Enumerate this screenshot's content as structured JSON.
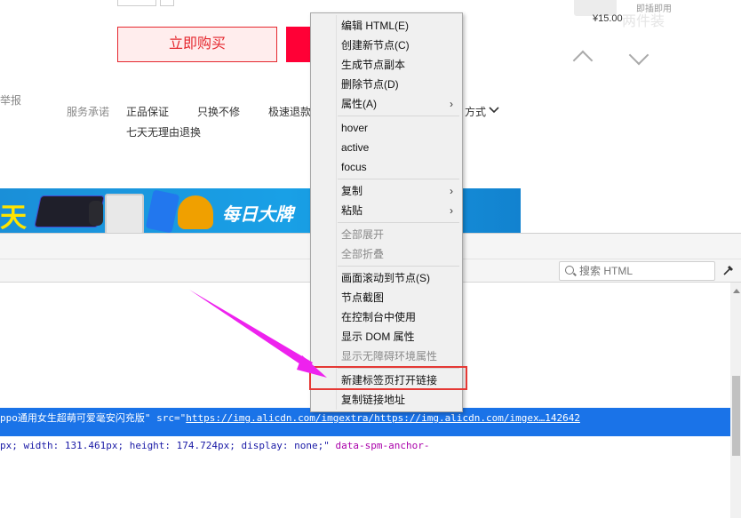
{
  "page": {
    "buy_now": "立即购买",
    "report_partial": "举报",
    "service_label": "服务承诺",
    "services": [
      "正品保证",
      "只换不修",
      "极速退款",
      "七天无理由退换"
    ],
    "payment_partial": "方式",
    "product_small_text": "即插即用",
    "product_ghost_text": "两件装",
    "product_price": "¥15.00",
    "banner_left": "天",
    "banner_text": "每日大牌"
  },
  "devtools": {
    "search_placeholder": "搜索 HTML",
    "selected_line": {
      "prefix": "ppo通用女生超萌可爱毫安闪充版\" src=\"",
      "url": "https://img.alicdn.com/imgextra/https://img.alicdn.com/imgex…142642"
    },
    "style_line": {
      "text": "px; width: 131.461px; height: 174.724px; display: none;\"",
      "attr": " data-spm-anchor-"
    }
  },
  "context_menu": {
    "items": [
      {
        "label": "编辑 HTML(E)",
        "disabled": false,
        "submenu": false
      },
      {
        "label": "创建新节点(C)",
        "disabled": false,
        "submenu": false
      },
      {
        "label": "生成节点副本",
        "disabled": false,
        "submenu": false
      },
      {
        "label": "删除节点(D)",
        "disabled": false,
        "submenu": false
      },
      {
        "label": "属性(A)",
        "disabled": false,
        "submenu": true
      },
      {
        "label": "hover",
        "disabled": false,
        "submenu": false
      },
      {
        "label": "active",
        "disabled": false,
        "submenu": false
      },
      {
        "label": "focus",
        "disabled": false,
        "submenu": false
      },
      {
        "label": "复制",
        "disabled": false,
        "submenu": true
      },
      {
        "label": "粘贴",
        "disabled": false,
        "submenu": true
      },
      {
        "label": "全部展开",
        "disabled": true,
        "submenu": false
      },
      {
        "label": "全部折叠",
        "disabled": true,
        "submenu": false
      },
      {
        "label": "画面滚动到节点(S)",
        "disabled": false,
        "submenu": false
      },
      {
        "label": "节点截图",
        "disabled": false,
        "submenu": false
      },
      {
        "label": "在控制台中使用",
        "disabled": false,
        "submenu": false
      },
      {
        "label": "显示 DOM 属性",
        "disabled": false,
        "submenu": false
      },
      {
        "label": "显示无障碍环境属性",
        "disabled": true,
        "submenu": false
      },
      {
        "label": "新建标签页打开链接",
        "disabled": false,
        "submenu": false
      },
      {
        "label": "复制链接地址",
        "disabled": false,
        "submenu": false
      }
    ],
    "submenu_glyph": "›"
  },
  "colors": {
    "accent_red": "#e5282f",
    "highlight_red": "#e53935",
    "annotation_magenta": "#ee22ee",
    "selection_blue": "#1a73e8"
  },
  "icons": {
    "pay_chevron": "chevron-down-icon",
    "search": "search-icon",
    "picker": "element-picker-icon"
  }
}
